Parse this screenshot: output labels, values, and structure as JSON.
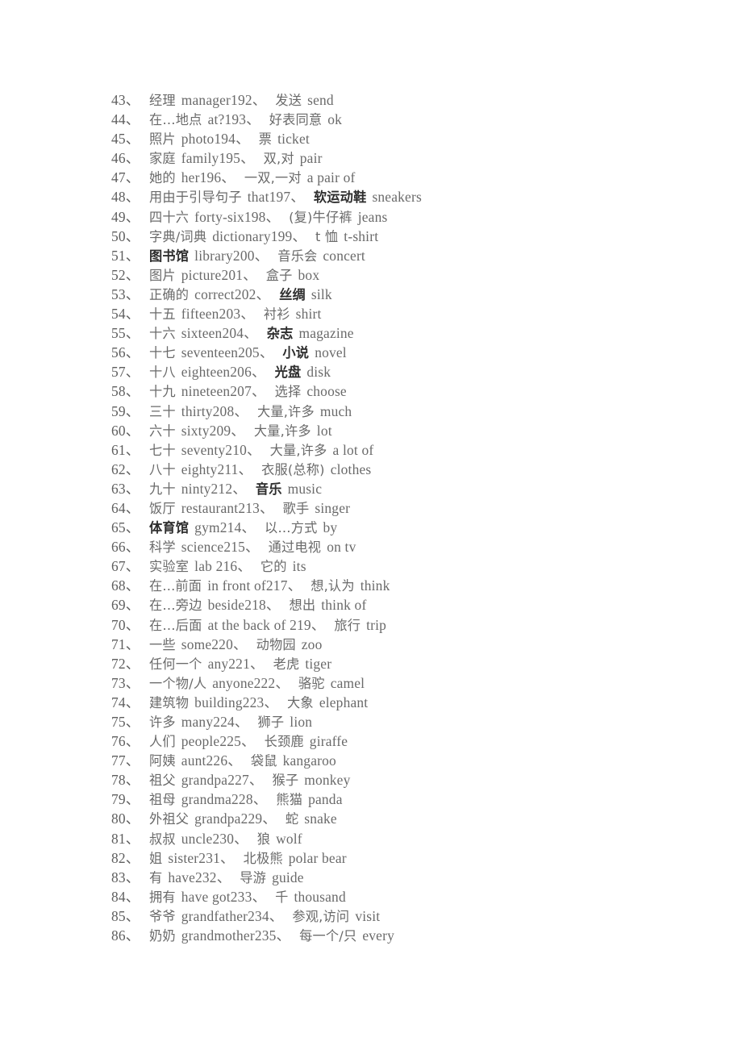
{
  "document": {
    "kind": "scanned-vocabulary-list",
    "language_pair": "Chinese-English",
    "background_color": "#ffffff",
    "text_color": "#6a6a6a",
    "bold_text_color": "#2e2e2e",
    "first_index": "43",
    "last_index": "86",
    "entry_count": 44
  },
  "entries": [
    {
      "index": "43、",
      "cn_a": "经理",
      "en_a": "manager192、",
      "cn_b": "发送",
      "en_b": "send",
      "bold_b": false
    },
    {
      "index": "44、",
      "cn_a": "在…地点",
      "en_a": "at?193、",
      "cn_b": "好表同意",
      "en_b": "ok",
      "bold_b": false
    },
    {
      "index": "45、",
      "cn_a": "照片",
      "en_a": "photo194、",
      "cn_b": "票",
      "en_b": "ticket",
      "bold_b": false
    },
    {
      "index": "46、",
      "cn_a": "家庭",
      "en_a": "family195、",
      "cn_b": "双,对",
      "en_b": "pair",
      "bold_b": false
    },
    {
      "index": "47、",
      "cn_a": "她的",
      "en_a": "her196、",
      "cn_b": "一双,一对",
      "en_b": "a pair of",
      "bold_b": false
    },
    {
      "index": "48、",
      "cn_a": "用由于引导句子",
      "en_a": "that197、",
      "cn_b": "软运动鞋",
      "en_b": "sneakers",
      "bold_b": true
    },
    {
      "index": "49、",
      "cn_a": "四十六",
      "en_a": "forty-six198、",
      "cn_b": "(复)牛仔裤",
      "en_b": "jeans",
      "bold_b": false
    },
    {
      "index": "50、",
      "cn_a": "字典/词典",
      "en_a": "dictionary199、",
      "cn_b": "t 恤",
      "en_b": "t-shirt",
      "bold_b": false
    },
    {
      "index": "51、",
      "cn_a": "图书馆",
      "en_a": "library200、",
      "cn_b": "音乐会",
      "en_b": "concert",
      "bold_a": true,
      "bold_b": false
    },
    {
      "index": "52、",
      "cn_a": "图片",
      "en_a": "picture201、",
      "cn_b": "盒子",
      "en_b": "box",
      "bold_b": false
    },
    {
      "index": "53、",
      "cn_a": "正确的",
      "en_a": "correct202、",
      "cn_b": "丝绸",
      "en_b": "silk",
      "bold_b": true
    },
    {
      "index": "54、",
      "cn_a": "十五",
      "en_a": "fifteen203、",
      "cn_b": "衬衫",
      "en_b": "shirt",
      "bold_b": false
    },
    {
      "index": "55、",
      "cn_a": "十六",
      "en_a": "sixteen204、",
      "cn_b": "杂志",
      "en_b": "magazine",
      "bold_b": true
    },
    {
      "index": "56、",
      "cn_a": "十七",
      "en_a": "seventeen205、",
      "cn_b": "小说",
      "en_b": "novel",
      "bold_b": true
    },
    {
      "index": "57、",
      "cn_a": "十八",
      "en_a": "eighteen206、",
      "cn_b": "光盘",
      "en_b": "disk",
      "bold_b": true
    },
    {
      "index": "58、",
      "cn_a": "十九",
      "en_a": "nineteen207、",
      "cn_b": "选择",
      "en_b": "choose",
      "bold_b": false
    },
    {
      "index": "59、",
      "cn_a": "三十",
      "en_a": "thirty208、",
      "cn_b": "大量,许多",
      "en_b": "much",
      "bold_b": false
    },
    {
      "index": "60、",
      "cn_a": "六十",
      "en_a": "sixty209、",
      "cn_b": "大量,许多",
      "en_b": "lot",
      "bold_b": false
    },
    {
      "index": "61、",
      "cn_a": "七十",
      "en_a": "seventy210、",
      "cn_b": "大量,许多",
      "en_b": "a lot of",
      "bold_b": false
    },
    {
      "index": "62、",
      "cn_a": "八十",
      "en_a": "eighty211、",
      "cn_b": "衣服(总称)",
      "en_b": "clothes",
      "bold_b": false
    },
    {
      "index": "63、",
      "cn_a": "九十",
      "en_a": "ninty212、",
      "cn_b": "音乐",
      "en_b": "music",
      "bold_b": true
    },
    {
      "index": "64、",
      "cn_a": "饭厅",
      "en_a": "restaurant213、",
      "cn_b": "歌手",
      "en_b": "singer",
      "bold_b": false
    },
    {
      "index": "65、",
      "cn_a": "体育馆",
      "en_a": "gym214、",
      "cn_b": "以…方式",
      "en_b": "by",
      "bold_a": true,
      "bold_b": false
    },
    {
      "index": "66、",
      "cn_a": "科学",
      "en_a": "science215、",
      "cn_b": "通过电视",
      "en_b": "on tv",
      "bold_b": false
    },
    {
      "index": "67、",
      "cn_a": "实验室",
      "en_a": "lab 216、",
      "cn_b": "它的",
      "en_b": "its",
      "bold_b": false
    },
    {
      "index": "68、",
      "cn_a": "在...前面",
      "en_a": "in front of217、",
      "cn_b": "想,认为",
      "en_b": "think",
      "bold_b": false
    },
    {
      "index": "69、",
      "cn_a": "在…旁边",
      "en_a": "beside218、",
      "cn_b": "想出",
      "en_b": "think of",
      "bold_b": false
    },
    {
      "index": "70、",
      "cn_a": "在…后面",
      "en_a": "at the back of 219、",
      "cn_b": "旅行",
      "en_b": "trip",
      "bold_b": false
    },
    {
      "index": "71、",
      "cn_a": "一些",
      "en_a": "some220、",
      "cn_b": "动物园",
      "en_b": "zoo",
      "bold_b": false
    },
    {
      "index": "72、",
      "cn_a": "任何一个",
      "en_a": "any221、",
      "cn_b": "老虎",
      "en_b": "tiger",
      "bold_b": false
    },
    {
      "index": "73、",
      "cn_a": "一个物/人",
      "en_a": "anyone222、",
      "cn_b": "骆驼",
      "en_b": "camel",
      "bold_b": false
    },
    {
      "index": "74、",
      "cn_a": "建筑物",
      "en_a": "building223、",
      "cn_b": "大象",
      "en_b": "elephant",
      "bold_b": false
    },
    {
      "index": "75、",
      "cn_a": "许多",
      "en_a": "many224、",
      "cn_b": "狮子",
      "en_b": "lion",
      "bold_b": false
    },
    {
      "index": "76、",
      "cn_a": "人们",
      "en_a": "people225、",
      "cn_b": "长颈鹿",
      "en_b": "giraffe",
      "bold_b": false
    },
    {
      "index": "77、",
      "cn_a": "阿姨",
      "en_a": "aunt226、",
      "cn_b": "袋鼠",
      "en_b": "kangaroo",
      "bold_b": false
    },
    {
      "index": "78、",
      "cn_a": "祖父",
      "en_a": "grandpa227、",
      "cn_b": "猴子",
      "en_b": "monkey",
      "bold_b": false
    },
    {
      "index": "79、",
      "cn_a": "祖母",
      "en_a": "grandma228、",
      "cn_b": "熊猫",
      "en_b": "panda",
      "bold_b": false
    },
    {
      "index": "80、",
      "cn_a": "外祖父",
      "en_a": "grandpa229、",
      "cn_b": "蛇",
      "en_b": "snake",
      "bold_b": false
    },
    {
      "index": "81、",
      "cn_a": "叔叔",
      "en_a": "uncle230、",
      "cn_b": "狼",
      "en_b": "wolf",
      "bold_b": false
    },
    {
      "index": "82、",
      "cn_a": "姐",
      "en_a": "sister231、",
      "cn_b": "北极熊",
      "en_b": "polar bear",
      "bold_b": false
    },
    {
      "index": "83、",
      "cn_a": "有",
      "en_a": "have232、",
      "cn_b": "导游",
      "en_b": "guide",
      "bold_b": false
    },
    {
      "index": "84、",
      "cn_a": "拥有",
      "en_a": "have got233、",
      "cn_b": "千",
      "en_b": "thousand",
      "bold_b": false
    },
    {
      "index": "85、",
      "cn_a": "爷爷",
      "en_a": "grandfather234、",
      "cn_b": "参观,访问",
      "en_b": "visit",
      "bold_b": false
    },
    {
      "index": "86、",
      "cn_a": "奶奶",
      "en_a": "grandmother235、",
      "cn_b": "每一个/只",
      "en_b": "every",
      "bold_b": false
    }
  ]
}
